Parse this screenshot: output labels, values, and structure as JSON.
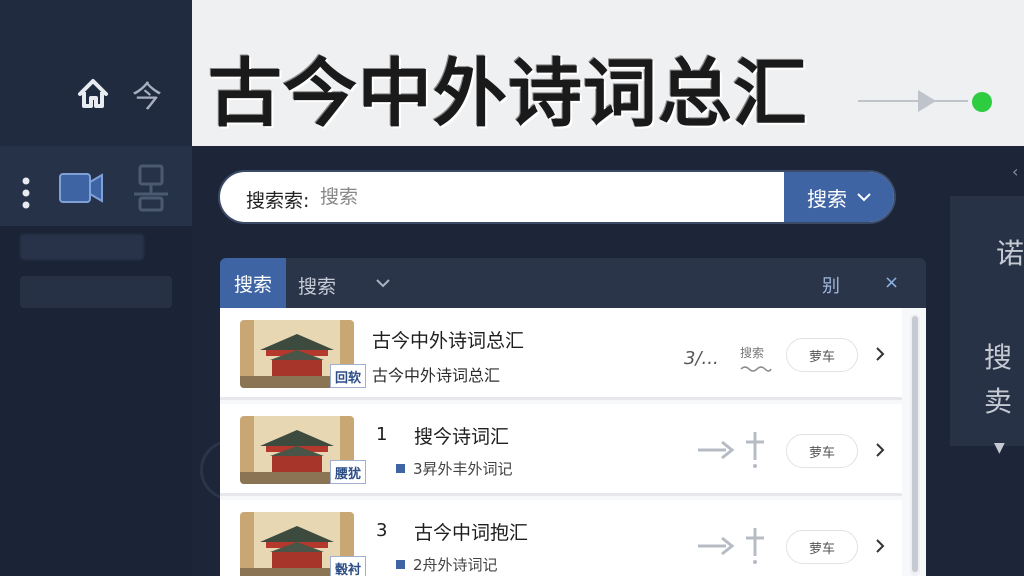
{
  "header": {
    "title": "古今中外诗词总汇"
  },
  "sidebar": {
    "top_char": "今",
    "icons": [
      "home-icon",
      "more-dots-icon",
      "video-icon",
      "tree-icon"
    ]
  },
  "search": {
    "label": "搜索索:",
    "placeholder": "搜索",
    "button_label": "搜索"
  },
  "results_tabs": {
    "active": "搜索",
    "second": "搜索",
    "right_label": "别",
    "close": "×"
  },
  "results": [
    {
      "title": "古今中外诗词总汇",
      "subtitle": "古今中外诗词总汇",
      "badge": "回软",
      "meta_fraction": "3/...",
      "meta_tag": "搜索",
      "button": "萝车"
    },
    {
      "number": "1",
      "title": "搜今诗词汇",
      "subtitle": "3昇外丰外词记",
      "badge": "腰犹",
      "button": "萝车"
    },
    {
      "number": "3",
      "title": "古今中词抱汇",
      "subtitle": "2舟外诗词记",
      "badge": "毂衬",
      "button": "萝车"
    }
  ],
  "right_panel": {
    "text1": "诺",
    "text2": "搜",
    "text3": "卖"
  },
  "colors": {
    "accent": "#3f64a3",
    "sidebar_bg": "#1b2436",
    "header_bg": "#eff0f2",
    "status_dot": "#2ecc40"
  }
}
